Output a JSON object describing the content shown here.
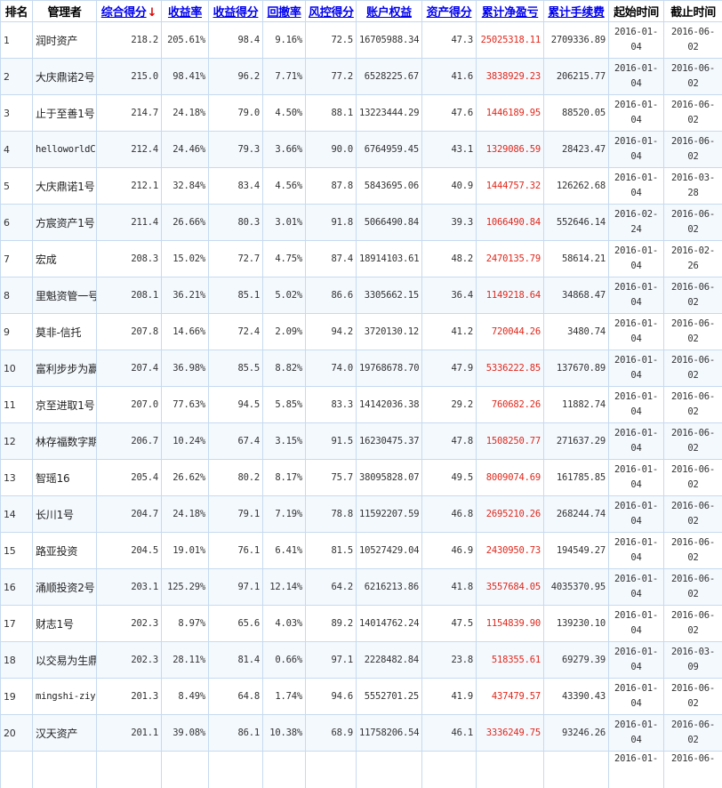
{
  "headers": [
    {
      "label": "排名",
      "sortable": false
    },
    {
      "label": "管理者",
      "sortable": false
    },
    {
      "label": "综合得分",
      "sortable": true,
      "active": true
    },
    {
      "label": "收益率",
      "sortable": true
    },
    {
      "label": "收益得分",
      "sortable": true
    },
    {
      "label": "回撤率",
      "sortable": true
    },
    {
      "label": "风控得分",
      "sortable": true
    },
    {
      "label": "账户权益",
      "sortable": true
    },
    {
      "label": "资产得分",
      "sortable": true
    },
    {
      "label": "累计净盈亏",
      "sortable": true
    },
    {
      "label": "累计手续费",
      "sortable": true
    },
    {
      "label": "起始时间",
      "sortable": false
    },
    {
      "label": "截止时间",
      "sortable": false
    }
  ],
  "sort_arrow": "↓",
  "colors": {
    "profit": "#e0281c",
    "link": "#0000ee",
    "grid": "#c6daf0",
    "row_alt": "#f4f9fe"
  },
  "rows": [
    {
      "rank": "1",
      "manager": "润时资产",
      "score": "218.2",
      "return_rate": "205.61%",
      "return_score": "98.4",
      "drawdown": "9.16%",
      "risk_score": "72.5",
      "equity": "16705988.34",
      "asset_score": "47.3",
      "net_pnl": "25025318.11",
      "fees": "2709336.89",
      "start": [
        "2016-01-",
        "04"
      ],
      "end": [
        "2016-06-",
        "02"
      ]
    },
    {
      "rank": "2",
      "manager": "大庆鼎诺2号",
      "score": "215.0",
      "return_rate": "98.41%",
      "return_score": "96.2",
      "drawdown": "7.71%",
      "risk_score": "77.2",
      "equity": "6528225.67",
      "asset_score": "41.6",
      "net_pnl": "3838929.23",
      "fees": "206215.77",
      "start": [
        "2016-01-",
        "04"
      ],
      "end": [
        "2016-06-",
        "02"
      ]
    },
    {
      "rank": "3",
      "manager": "止于至善1号",
      "score": "214.7",
      "return_rate": "24.18%",
      "return_score": "79.0",
      "drawdown": "4.50%",
      "risk_score": "88.1",
      "equity": "13223444.29",
      "asset_score": "47.6",
      "net_pnl": "1446189.95",
      "fees": "88520.05",
      "start": [
        "2016-01-",
        "04"
      ],
      "end": [
        "2016-06-",
        "02"
      ]
    },
    {
      "rank": "4",
      "manager": "helloworldC",
      "latin": true,
      "score": "212.4",
      "return_rate": "24.46%",
      "return_score": "79.3",
      "drawdown": "3.66%",
      "risk_score": "90.0",
      "equity": "6764959.45",
      "asset_score": "43.1",
      "net_pnl": "1329086.59",
      "fees": "28423.47",
      "start": [
        "2016-01-",
        "04"
      ],
      "end": [
        "2016-06-",
        "02"
      ]
    },
    {
      "rank": "5",
      "manager": "大庆鼎诺1号",
      "score": "212.1",
      "return_rate": "32.84%",
      "return_score": "83.4",
      "drawdown": "4.56%",
      "risk_score": "87.8",
      "equity": "5843695.06",
      "asset_score": "40.9",
      "net_pnl": "1444757.32",
      "fees": "126262.68",
      "start": [
        "2016-01-",
        "04"
      ],
      "end": [
        "2016-03-",
        "28"
      ]
    },
    {
      "rank": "6",
      "manager": "方宸资产1号",
      "score": "211.4",
      "return_rate": "26.66%",
      "return_score": "80.3",
      "drawdown": "3.01%",
      "risk_score": "91.8",
      "equity": "5066490.84",
      "asset_score": "39.3",
      "net_pnl": "1066490.84",
      "fees": "552646.14",
      "start": [
        "2016-02-",
        "24"
      ],
      "end": [
        "2016-06-",
        "02"
      ]
    },
    {
      "rank": "7",
      "manager": "宏成",
      "score": "208.3",
      "return_rate": "15.02%",
      "return_score": "72.7",
      "drawdown": "4.75%",
      "risk_score": "87.4",
      "equity": "18914103.61",
      "asset_score": "48.2",
      "net_pnl": "2470135.79",
      "fees": "58614.21",
      "start": [
        "2016-01-",
        "04"
      ],
      "end": [
        "2016-02-",
        "26"
      ]
    },
    {
      "rank": "8",
      "manager": "里魁资管一号",
      "score": "208.1",
      "return_rate": "36.21%",
      "return_score": "85.1",
      "drawdown": "5.02%",
      "risk_score": "86.6",
      "equity": "3305662.15",
      "asset_score": "36.4",
      "net_pnl": "1149218.64",
      "fees": "34868.47",
      "start": [
        "2016-01-",
        "04"
      ],
      "end": [
        "2016-06-",
        "02"
      ]
    },
    {
      "rank": "9",
      "manager": "莫非-信托",
      "score": "207.8",
      "return_rate": "14.66%",
      "return_score": "72.4",
      "drawdown": "2.09%",
      "risk_score": "94.2",
      "equity": "3720130.12",
      "asset_score": "41.2",
      "net_pnl": "720044.26",
      "fees": "3480.74",
      "start": [
        "2016-01-",
        "04"
      ],
      "end": [
        "2016-06-",
        "02"
      ]
    },
    {
      "rank": "10",
      "manager": "富利步步为赢",
      "score": "207.4",
      "return_rate": "36.98%",
      "return_score": "85.5",
      "drawdown": "8.82%",
      "risk_score": "74.0",
      "equity": "19768678.70",
      "asset_score": "47.9",
      "net_pnl": "5336222.85",
      "fees": "137670.89",
      "start": [
        "2016-01-",
        "04"
      ],
      "end": [
        "2016-06-",
        "02"
      ]
    },
    {
      "rank": "11",
      "manager": "京至进取1号",
      "score": "207.0",
      "return_rate": "77.63%",
      "return_score": "94.5",
      "drawdown": "5.85%",
      "risk_score": "83.3",
      "equity": "14142036.38",
      "asset_score": "29.2",
      "net_pnl": "760682.26",
      "fees": "11882.74",
      "start": [
        "2016-01-",
        "04"
      ],
      "end": [
        "2016-06-",
        "02"
      ]
    },
    {
      "rank": "12",
      "manager": "林存福数字期",
      "score": "206.7",
      "return_rate": "10.24%",
      "return_score": "67.4",
      "drawdown": "3.15%",
      "risk_score": "91.5",
      "equity": "16230475.37",
      "asset_score": "47.8",
      "net_pnl": "1508250.77",
      "fees": "271637.29",
      "start": [
        "2016-01-",
        "04"
      ],
      "end": [
        "2016-06-",
        "02"
      ]
    },
    {
      "rank": "13",
      "manager": "智瑶16",
      "score": "205.4",
      "return_rate": "26.62%",
      "return_score": "80.2",
      "drawdown": "8.17%",
      "risk_score": "75.7",
      "equity": "38095828.07",
      "asset_score": "49.5",
      "net_pnl": "8009074.69",
      "fees": "161785.85",
      "start": [
        "2016-01-",
        "04"
      ],
      "end": [
        "2016-06-",
        "02"
      ]
    },
    {
      "rank": "14",
      "manager": "长川1号",
      "score": "204.7",
      "return_rate": "24.18%",
      "return_score": "79.1",
      "drawdown": "7.19%",
      "risk_score": "78.8",
      "equity": "11592207.59",
      "asset_score": "46.8",
      "net_pnl": "2695210.26",
      "fees": "268244.74",
      "start": [
        "2016-01-",
        "04"
      ],
      "end": [
        "2016-06-",
        "02"
      ]
    },
    {
      "rank": "15",
      "manager": "路亚投资",
      "score": "204.5",
      "return_rate": "19.01%",
      "return_score": "76.1",
      "drawdown": "6.41%",
      "risk_score": "81.5",
      "equity": "10527429.04",
      "asset_score": "46.9",
      "net_pnl": "2430950.73",
      "fees": "194549.27",
      "start": [
        "2016-01-",
        "04"
      ],
      "end": [
        "2016-06-",
        "02"
      ]
    },
    {
      "rank": "16",
      "manager": "涌顺投资2号",
      "score": "203.1",
      "return_rate": "125.29%",
      "return_score": "97.1",
      "drawdown": "12.14%",
      "risk_score": "64.2",
      "equity": "6216213.86",
      "asset_score": "41.8",
      "net_pnl": "3557684.05",
      "fees": "4035370.95",
      "start": [
        "2016-01-",
        "04"
      ],
      "end": [
        "2016-06-",
        "02"
      ]
    },
    {
      "rank": "17",
      "manager": "财志1号",
      "score": "202.3",
      "return_rate": "8.97%",
      "return_score": "65.6",
      "drawdown": "4.03%",
      "risk_score": "89.2",
      "equity": "14014762.24",
      "asset_score": "47.5",
      "net_pnl": "1154839.90",
      "fees": "139230.10",
      "start": [
        "2016-01-",
        "04"
      ],
      "end": [
        "2016-06-",
        "02"
      ]
    },
    {
      "rank": "18",
      "manager": "以交易为生鼎",
      "score": "202.3",
      "return_rate": "28.11%",
      "return_score": "81.4",
      "drawdown": "0.66%",
      "risk_score": "97.1",
      "equity": "2228482.84",
      "asset_score": "23.8",
      "net_pnl": "518355.61",
      "fees": "69279.39",
      "start": [
        "2016-01-",
        "04"
      ],
      "end": [
        "2016-03-",
        "09"
      ]
    },
    {
      "rank": "19",
      "manager": "mingshi-ziy",
      "latin": true,
      "score": "201.3",
      "return_rate": "8.49%",
      "return_score": "64.8",
      "drawdown": "1.74%",
      "risk_score": "94.6",
      "equity": "5552701.25",
      "asset_score": "41.9",
      "net_pnl": "437479.57",
      "fees": "43390.43",
      "start": [
        "2016-01-",
        "04"
      ],
      "end": [
        "2016-06-",
        "02"
      ]
    },
    {
      "rank": "20",
      "manager": "汉天资产",
      "score": "201.1",
      "return_rate": "39.08%",
      "return_score": "86.1",
      "drawdown": "10.38%",
      "risk_score": "68.9",
      "equity": "11758206.54",
      "asset_score": "46.1",
      "net_pnl": "3336249.75",
      "fees": "93246.26",
      "start": [
        "2016-01-",
        "04"
      ],
      "end": [
        "2016-06-",
        "02"
      ]
    }
  ],
  "partial_row": {
    "start": "2016-01-",
    "end": "2016-06-"
  }
}
